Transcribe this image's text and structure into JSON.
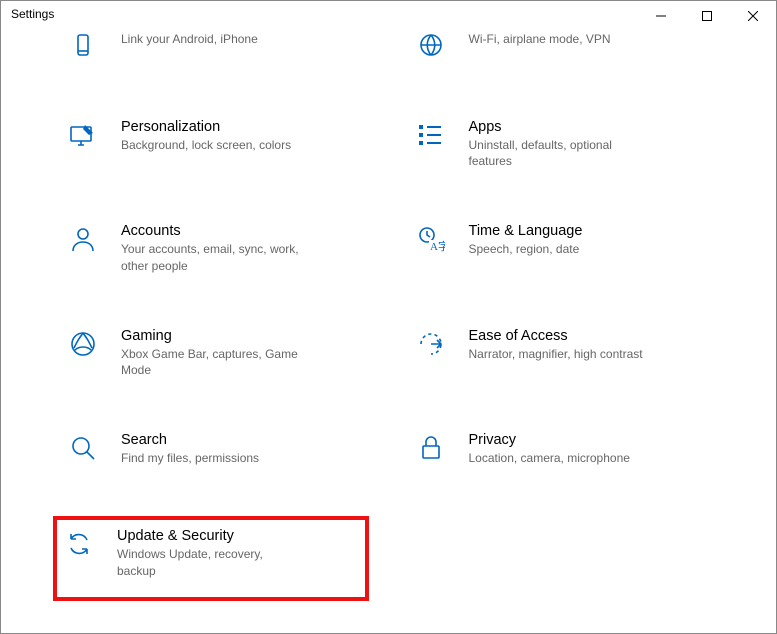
{
  "window": {
    "title": "Settings"
  },
  "categories": {
    "phone": {
      "title": "",
      "desc": "Link your Android, iPhone"
    },
    "network": {
      "title": "",
      "desc": "Wi-Fi, airplane mode, VPN"
    },
    "personalization": {
      "title": "Personalization",
      "desc": "Background, lock screen, colors"
    },
    "apps": {
      "title": "Apps",
      "desc": "Uninstall, defaults, optional features"
    },
    "accounts": {
      "title": "Accounts",
      "desc": "Your accounts, email, sync, work, other people"
    },
    "time": {
      "title": "Time & Language",
      "desc": "Speech, region, date"
    },
    "gaming": {
      "title": "Gaming",
      "desc": "Xbox Game Bar, captures, Game Mode"
    },
    "ease": {
      "title": "Ease of Access",
      "desc": "Narrator, magnifier, high contrast"
    },
    "search": {
      "title": "Search",
      "desc": "Find my files, permissions"
    },
    "privacy": {
      "title": "Privacy",
      "desc": "Location, camera, microphone"
    },
    "update": {
      "title": "Update & Security",
      "desc": "Windows Update, recovery, backup"
    }
  }
}
